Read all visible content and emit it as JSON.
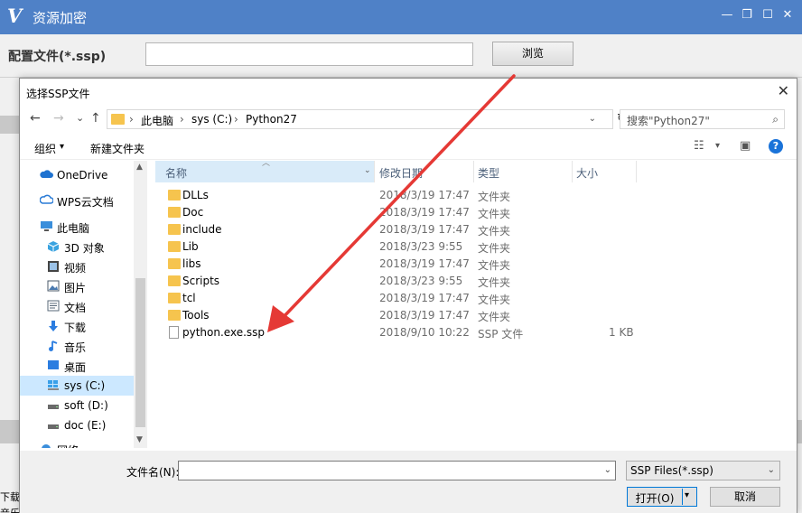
{
  "app": {
    "logo": "V",
    "title": "资源加密",
    "minimize": "—",
    "restore": "❐",
    "maximize": "☐",
    "close": "✕",
    "config_label": "配置文件(*.ssp)",
    "config_value": "",
    "browse_label": "浏览",
    "bg_text_1": "下载",
    "bg_text_2": "音乐"
  },
  "dialog": {
    "title": "选择SSP文件",
    "close": "✕",
    "nav": {
      "back": "←",
      "forward": "→",
      "recent": "⌄",
      "up": "↑"
    },
    "address": {
      "sep": "›",
      "segments": [
        "此电脑",
        "sys (C:)",
        "Python27"
      ],
      "dropdown": "⌄",
      "refresh": "↻"
    },
    "search": {
      "placeholder": "搜索\"Python27\"",
      "icon": "⌕"
    },
    "toolbar": {
      "organize": "组织",
      "organize_arrow": "▾",
      "new_folder": "新建文件夹",
      "view_icon": "☷",
      "view_arrow": "▾",
      "pane_icon": "▣",
      "help": "?"
    },
    "tree": [
      {
        "label": "OneDrive",
        "icon": "cloud",
        "color": "#1e72d0"
      },
      {
        "label": "WPS云文档",
        "icon": "cloud",
        "color": "#2a7bd6"
      },
      {
        "label": "此电脑",
        "icon": "computer",
        "color": "#3a8edb"
      },
      {
        "label": "3D 对象",
        "icon": "cube",
        "color": "#3aa3e0"
      },
      {
        "label": "视频",
        "icon": "video",
        "color": "#555555"
      },
      {
        "label": "图片",
        "icon": "picture",
        "color": "#4a5a6a"
      },
      {
        "label": "文档",
        "icon": "document",
        "color": "#5a6a7a"
      },
      {
        "label": "下载",
        "icon": "download",
        "color": "#2b7de0"
      },
      {
        "label": "音乐",
        "icon": "music",
        "color": "#2b7de0"
      },
      {
        "label": "桌面",
        "icon": "desktop",
        "color": "#2b7de0"
      },
      {
        "label": "sys (C:)",
        "icon": "drive-windows",
        "color": "#3aa0e8"
      },
      {
        "label": "soft (D:)",
        "icon": "drive",
        "color": "#6a6a6a"
      },
      {
        "label": "doc (E:)",
        "icon": "drive",
        "color": "#6a6a6a"
      },
      {
        "label": "网络",
        "icon": "network",
        "color": "#3a8edb"
      }
    ],
    "scroll": {
      "up": "▲",
      "down": "▼"
    },
    "columns": {
      "name": "名称",
      "sort_arrow": "︿",
      "filter_arrow": "⌄",
      "date": "修改日期",
      "type": "类型",
      "size": "大小"
    },
    "files": [
      {
        "name": "DLLs",
        "date": "2018/3/19 17:47",
        "type": "文件夹",
        "size": "",
        "kind": "folder"
      },
      {
        "name": "Doc",
        "date": "2018/3/19 17:47",
        "type": "文件夹",
        "size": "",
        "kind": "folder"
      },
      {
        "name": "include",
        "date": "2018/3/19 17:47",
        "type": "文件夹",
        "size": "",
        "kind": "folder"
      },
      {
        "name": "Lib",
        "date": "2018/3/23 9:55",
        "type": "文件夹",
        "size": "",
        "kind": "folder"
      },
      {
        "name": "libs",
        "date": "2018/3/19 17:47",
        "type": "文件夹",
        "size": "",
        "kind": "folder"
      },
      {
        "name": "Scripts",
        "date": "2018/3/23 9:55",
        "type": "文件夹",
        "size": "",
        "kind": "folder"
      },
      {
        "name": "tcl",
        "date": "2018/3/19 17:47",
        "type": "文件夹",
        "size": "",
        "kind": "folder"
      },
      {
        "name": "Tools",
        "date": "2018/3/19 17:47",
        "type": "文件夹",
        "size": "",
        "kind": "folder"
      },
      {
        "name": "python.exe.ssp",
        "date": "2018/9/10 10:22",
        "type": "SSP 文件",
        "size": "1 KB",
        "kind": "file"
      }
    ],
    "bottom": {
      "filename_label": "文件名(N):",
      "filename_value": "",
      "filename_drop": "⌄",
      "filter_value": "SSP Files(*.ssp)",
      "filter_drop": "⌄",
      "open_label": "打开(O)",
      "open_drop": "▾",
      "cancel_label": "取消"
    }
  },
  "annotation": {
    "arrow_color": "#e53935"
  }
}
